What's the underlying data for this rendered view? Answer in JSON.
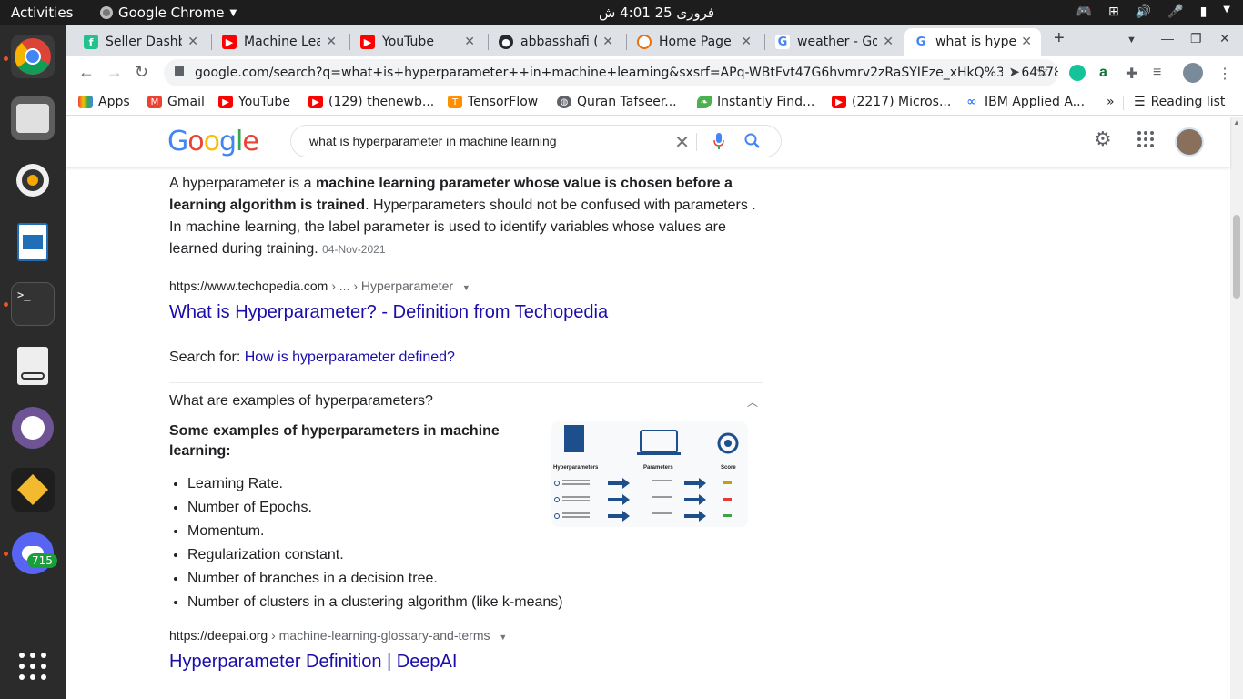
{
  "os": {
    "activities": "Activities",
    "app_name": "Google Chrome",
    "clock": "فروری 25  4:01 ش"
  },
  "dock": {
    "discord_badge": "715"
  },
  "tabs": [
    {
      "title": "Seller Dashbo",
      "favicon_color": "#21c28e"
    },
    {
      "title": "Machine Lear",
      "favicon_color": "#ff0000"
    },
    {
      "title": "YouTube",
      "favicon_color": "#ff0000"
    },
    {
      "title": "abbasshafi (A",
      "favicon_color": "#24292e"
    },
    {
      "title": "Home Page -",
      "favicon_color": "#e8710a"
    },
    {
      "title": "weather - Go",
      "favicon_color": "#4285f4"
    },
    {
      "title": "what is hyper",
      "favicon_color": "#4285f4"
    }
  ],
  "new_tab": "+",
  "url": "google.com/search?q=what+is+hyperparameter++in+machine+learning&sxsrf=APq-WBtFvt47G6hvmrv2zRaSYIEze_xHkQ%3A164578682...",
  "bookmarks": [
    {
      "label": "Apps",
      "icon_color": "#4285f4"
    },
    {
      "label": "Gmail",
      "icon_color": "#ea4335"
    },
    {
      "label": "YouTube",
      "icon_color": "#ff0000"
    },
    {
      "label": "(129) thenewb...",
      "icon_color": "#ff0000"
    },
    {
      "label": "TensorFlow",
      "icon_color": "#ff8f00"
    },
    {
      "label": "Quran Tafseer...",
      "icon_color": "#5f6368"
    },
    {
      "label": "Instantly Find...",
      "icon_color": "#4caf50"
    },
    {
      "label": "(2217) Micros...",
      "icon_color": "#ff0000"
    },
    {
      "label": "IBM Applied A...",
      "icon_color": "#0f62fe"
    }
  ],
  "bookmarks_more": "»",
  "reading_list": "Reading list",
  "google": {
    "logo": "Google",
    "query": "what is hyperparameter  in machine learning"
  },
  "snippet": {
    "text1": "A hyperparameter is a ",
    "bold": "machine learning parameter whose value is chosen before a learning algorithm is trained",
    "text2": ". Hyperparameters should not be confused with parameters . In machine learning, the label parameter is used to identify variables whose values are learned during training.",
    "date": "04-Nov-2021"
  },
  "result1": {
    "domain": "https://www.techopedia.com",
    "crumb": " › ... › Hyperparameter",
    "title": "What is Hyperparameter? - Definition from Techopedia"
  },
  "search_for": {
    "label": "Search for: ",
    "link": "How is hyperparameter defined?"
  },
  "paa": {
    "question": "What are examples of hyperparameters?",
    "answer_title": "Some examples of hyperparameters in machine learning:",
    "items": [
      "Learning Rate.",
      "Number of Epochs.",
      "Momentum.",
      "Regularization constant.",
      "Number of branches in a decision tree.",
      "Number of clusters in a clustering algorithm (like k-means)"
    ],
    "image_labels": [
      "Hyperparameters",
      "Parameters",
      "Score"
    ]
  },
  "result2": {
    "domain": "https://deepai.org",
    "crumb": " › machine-learning-glossary-and-terms",
    "title": "Hyperparameter Definition | DeepAI"
  }
}
